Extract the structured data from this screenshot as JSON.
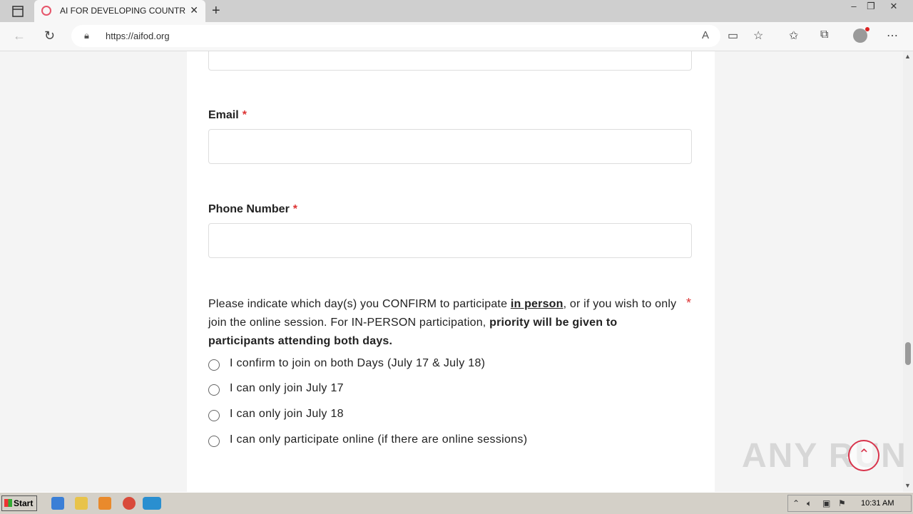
{
  "browser": {
    "tab_title": "AI FOR DEVELOPING COUNTRIES",
    "url": "https://aifod.org",
    "new_tab_symbol": "+",
    "close_symbol": "✕"
  },
  "form": {
    "email_label": "Email",
    "phone_label": "Phone Number",
    "required_mark": "*",
    "question": {
      "part1": "Please indicate which day(s) you CONFIRM to participate ",
      "emphasis": "in person",
      "part2": ", or if you wish to only join the online session. For IN-PERSON participation, ",
      "bold": "priority will be given to participants attending both days."
    },
    "options": [
      "I confirm to join on both Days (July 17 & July 18)",
      "I can only join July 17",
      "I can only join July 18",
      "I can only participate online (if there are online sessions)"
    ]
  },
  "watermark": "ANY RUN",
  "taskbar": {
    "start_label": "Start",
    "time": "10:31 AM"
  },
  "colors": {
    "required": "#dd3333",
    "totop_accent": "#d8344c"
  }
}
